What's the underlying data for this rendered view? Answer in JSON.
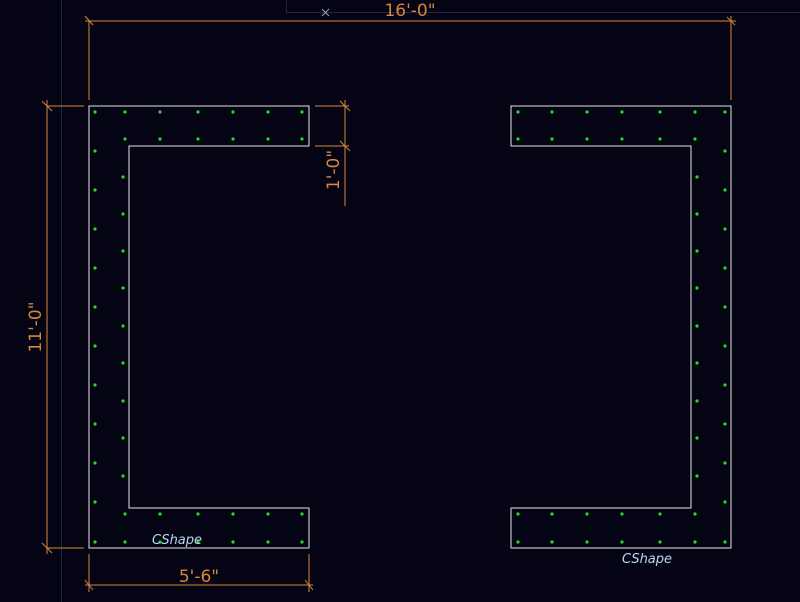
{
  "colors": {
    "background": "#040414",
    "outline": "#e6e6e6",
    "rebar": "#1fe01f",
    "dimension": "#d7873a",
    "label": "#b9d8f0",
    "grid": "#23233d"
  },
  "dimensions": {
    "overall_width": "16'-0\"",
    "overall_height": "11'-0\"",
    "flange_thickness": "1'-0\"",
    "flange_length": "5'-6\""
  },
  "shapes": {
    "left": {
      "label": "CShape"
    },
    "right": {
      "label": "CShape"
    }
  },
  "cursor": {
    "icon": "crosshair-x-icon"
  }
}
